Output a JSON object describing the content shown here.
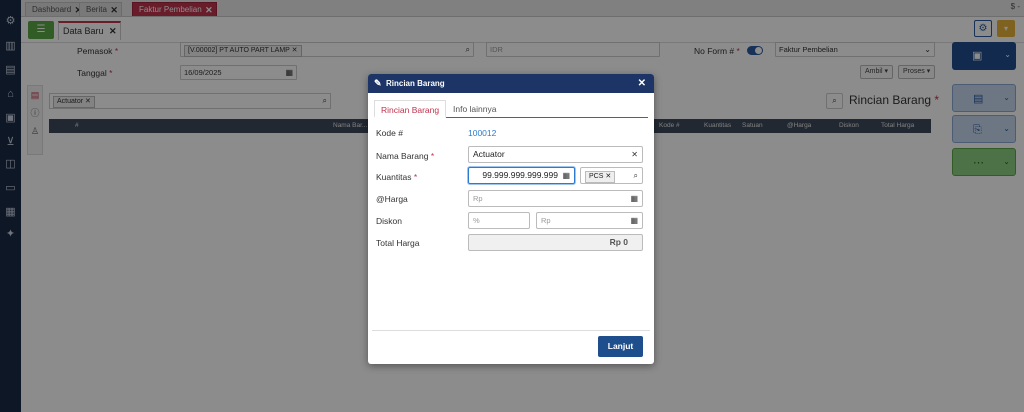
{
  "tabs": [
    {
      "label": "Dashboard",
      "active": false
    },
    {
      "label": "Berita",
      "active": false
    },
    {
      "label": "Faktur Pembelian",
      "active": true
    }
  ],
  "topbar_corner": "$ -",
  "subtab": {
    "label": "Data Baru"
  },
  "form": {
    "pemasok_label": "Pemasok",
    "pemasok_value": "[V.00002] PT AUTO PART LAMP",
    "currency_value": "IDR",
    "tanggal_label": "Tanggal",
    "tanggal_value": "16/09/2025",
    "noform_label": "No Form #",
    "noform_select": "Faktur Pembelian",
    "ambil_label": "Ambil",
    "proses_label": "Proses"
  },
  "grid": {
    "search_chip": "Actuator",
    "title": "Rincian Barang",
    "columns_left": [
      "#",
      "Nama Bar..."
    ],
    "columns_right": [
      "Kode #",
      "Kuantitas",
      "Satuan",
      "@Harga",
      "Diskon",
      "Total Harga"
    ]
  },
  "modal": {
    "title": "Rincian Barang",
    "tabs": [
      "Rincian Barang",
      "Info lainnya"
    ],
    "kode_label": "Kode #",
    "kode_value": "100012",
    "nama_label": "Nama Barang",
    "nama_value": "Actuator",
    "kuantitas_label": "Kuantitas",
    "kuantitas_value": "99.999.999.999.999",
    "satuan_chip": "PCS",
    "harga_label": "@Harga",
    "harga_placeholder": "Rp",
    "diskon_label": "Diskon",
    "diskon_pct_placeholder": "%",
    "diskon_rp_placeholder": "Rp",
    "total_label": "Total Harga",
    "total_value": "Rp 0",
    "lanjut_label": "Lanjut"
  },
  "colors": {
    "accent": "#c0334d",
    "primary": "#1f4e8c",
    "header": "#1c3566",
    "sidebar": "#1b2a45",
    "green": "#5aa845"
  }
}
